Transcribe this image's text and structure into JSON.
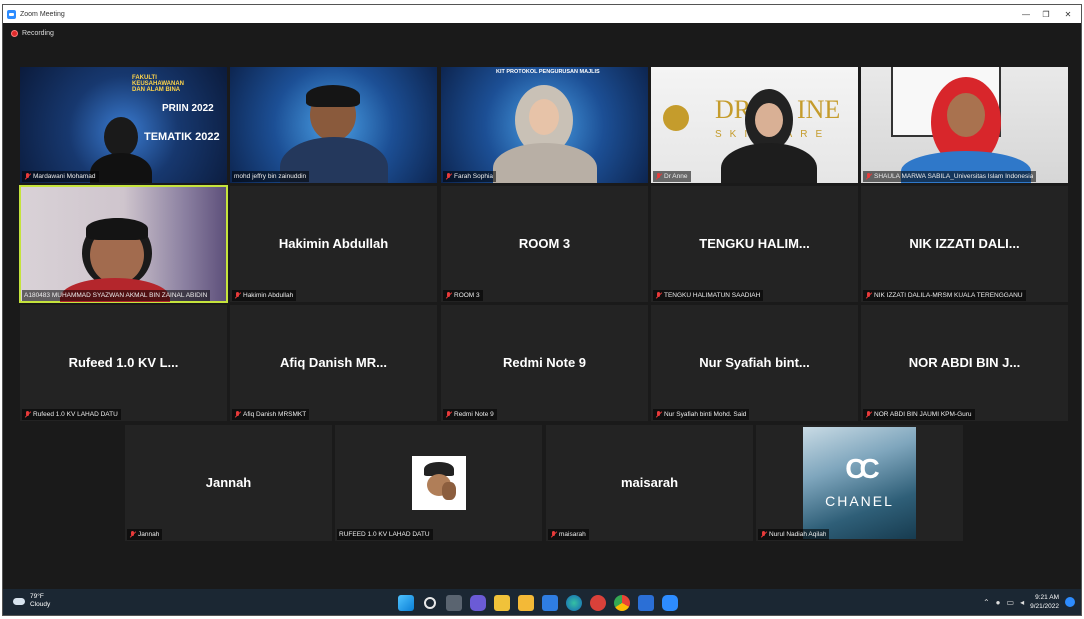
{
  "window": {
    "title": "Zoom Meeting",
    "controls": [
      "—",
      "❐",
      "✕"
    ]
  },
  "recording": {
    "label": "Recording"
  },
  "tiles": [
    {
      "name": "Mardawani Mohamad",
      "banner": [
        "FAKULTI",
        "KEUSAHAWANAN",
        "DAN ALAM BINA",
        "PRIIN 2022",
        "TEMATIK 2022"
      ]
    },
    {
      "name": "mohd jeffry bin zainuddin"
    },
    {
      "name": "Farah Sophia",
      "banner": [
        "KIT PROTOKOL PENGURUSAN MAJLIS"
      ]
    },
    {
      "name": "Dr Anne",
      "banner": [
        "DR",
        "INE",
        "SKINCARE"
      ]
    },
    {
      "name": "SHAULA MARWA SABILA_Universitas Islam Indonesia"
    },
    {
      "name": "A180483 MUHAMMAD SYAZWAN AKMAL BIN ZAINAL ABIDIN"
    },
    {
      "display": "Hakimin Abdullah",
      "name": "Hakimin Abdullah"
    },
    {
      "display": "ROOM 3",
      "name": "ROOM 3"
    },
    {
      "display": "TENGKU HALIM...",
      "name": "TENGKU HALIMATUN SAADIAH"
    },
    {
      "display": "NIK IZZATI DALI...",
      "name": "NIK IZZATI DALILA-MRSM KUALA TERENGGANU"
    },
    {
      "display": "Rufeed 1.0 KV L...",
      "name": "Rufeed 1.0 KV LAHAD DATU"
    },
    {
      "display": "Afiq Danish MR...",
      "name": "Afiq Danish MRSMKT"
    },
    {
      "display": "Redmi Note 9",
      "name": "Redmi Note 9"
    },
    {
      "display": "Nur Syafiah bint...",
      "name": "Nur Syafiah binti Mohd. Said"
    },
    {
      "display": "NOR ABDI BIN J...",
      "name": "NOR ABDI BIN JAUMI KPM-Guru"
    },
    {
      "display": "Jannah",
      "name": "Jannah"
    },
    {
      "name": "RUFEED 1.0 KV LAHAD DATU"
    },
    {
      "display": "maisarah",
      "name": "maisarah"
    },
    {
      "name": "Nurul Nadiah Aqilah",
      "banner": [
        "CC",
        "CHANEL"
      ]
    }
  ],
  "taskbar": {
    "weather": {
      "temp": "79°F",
      "condition": "Cloudy"
    },
    "clock": {
      "time": "9:21 AM",
      "date": "9/21/2022"
    }
  },
  "colors": {
    "active_speaker": "#c5e43c",
    "muted_icon": "#e83a3a",
    "tile_bg": "#232323"
  }
}
